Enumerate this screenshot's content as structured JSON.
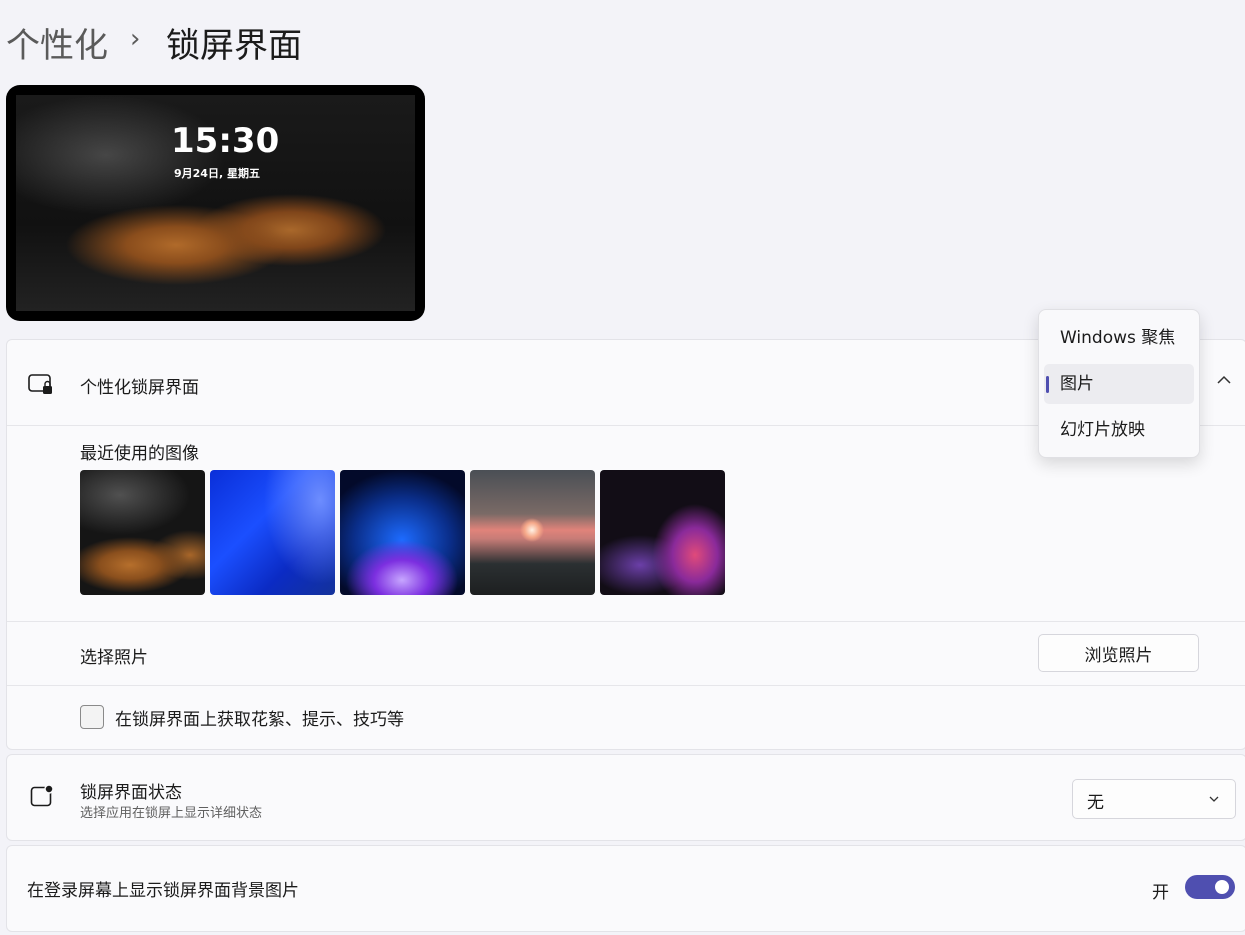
{
  "breadcrumb": {
    "parent": "个性化",
    "separator": "›",
    "current": "锁屏界面"
  },
  "preview": {
    "time": "15:30",
    "date": "9月24日, 星期五"
  },
  "personalize_lock_screen": {
    "label": "个性化锁屏界面",
    "recent_images_label": "最近使用的图像",
    "choose_photo_label": "选择照片",
    "browse_button_label": "浏览照片",
    "fun_facts_checkbox_label": "在锁屏界面上获取花絮、提示、技巧等",
    "fun_facts_checked": false
  },
  "dropdown": {
    "options": [
      "Windows 聚焦",
      "图片",
      "幻灯片放映"
    ],
    "selected": "图片"
  },
  "lock_screen_status": {
    "label": "锁屏界面状态",
    "sublabel": "选择应用在锁屏上显示详细状态",
    "value": "无"
  },
  "show_background_on_signin": {
    "label": "在登录屏幕上显示锁屏界面背景图片",
    "state_label": "开",
    "enabled": true
  },
  "colors": {
    "accent": "#4f4fb0"
  }
}
